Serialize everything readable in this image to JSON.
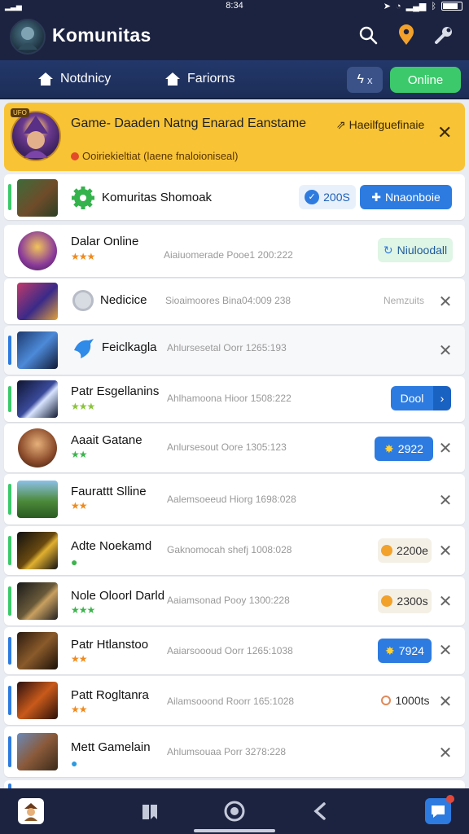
{
  "status_bar": {
    "time": "8:34"
  },
  "app_bar": {
    "title": "Komunitas",
    "icons": [
      "search-icon",
      "location-pin-icon",
      "tools-icon"
    ]
  },
  "nav_bar": {
    "items": [
      {
        "label": "Notdnicy",
        "icon": "home-icon"
      },
      {
        "label": "Fariorns",
        "icon": "home-icon"
      }
    ],
    "flash_label": "x",
    "online_label": "Online"
  },
  "banner": {
    "tag": "UFO",
    "title": "Game- Daaden Natng Enarad Eanstame",
    "subtitle": "Ooiriekieltiat (laene fnaloioniseal)",
    "link": "Haeilfguefinaie"
  },
  "games": [
    {
      "name": "Komuritas Shomoak",
      "meta": "",
      "stars": "",
      "pill": "200S",
      "button": "Nnaonboie",
      "close": false
    },
    {
      "name": "Dalar Online",
      "meta": "Aiaiuomerade Pooe1 200:222",
      "stars": "★★★",
      "pill": "Niuloodall",
      "close": false
    },
    {
      "name": "Nedicice",
      "meta": "Sioaimoores Bina04:009 238",
      "stars": "",
      "pill": "Nemzuits",
      "close": true
    },
    {
      "name": "Feiclkagla",
      "meta": "Ahlursesetal Oorr 1265:193",
      "stars": "",
      "pill": "",
      "close": true
    },
    {
      "name": "Patr Esgellanins",
      "meta": "Ahlhamoona Hioor 1508:222",
      "stars": "★★★",
      "pill": "Dool",
      "close": false
    },
    {
      "name": "Aaait Gatane",
      "meta": "Anlursesout Oore 1305:123",
      "stars": "★★",
      "pill": "2922",
      "close": true
    },
    {
      "name": "Faurattt Slline",
      "meta": "Aalemsoeeud Hiorg 1698:028",
      "stars": "★★",
      "pill": "",
      "close": true
    },
    {
      "name": "Adte Noekamd",
      "meta": "Gaknomocah shefj 1008:028",
      "stars": "●",
      "pill": "2200e",
      "close": true
    },
    {
      "name": "Nole Oloorl Darld",
      "meta": "Aaiamsonad Pooy 1300:228",
      "stars": "★★★",
      "pill": "2300s",
      "close": true
    },
    {
      "name": "Patr Htlanstoo",
      "meta": "Aaiarsoooud Oorr 1265:1038",
      "stars": "★★",
      "pill": "7924",
      "close": true
    },
    {
      "name": "Patt Rogltanra",
      "meta": "Ailamsooond Roorr 165:1028",
      "stars": "★★",
      "pill": "1000ts",
      "close": true
    },
    {
      "name": "Mett Gamelain",
      "meta": "Ahlumsouaa Porr 3278:228",
      "stars": "●",
      "pill": "",
      "close": true
    }
  ],
  "bottom_nav": [
    "profile-avatar-icon",
    "bookmark-icon",
    "record-icon",
    "back-arrow-icon",
    "chat-icon"
  ]
}
